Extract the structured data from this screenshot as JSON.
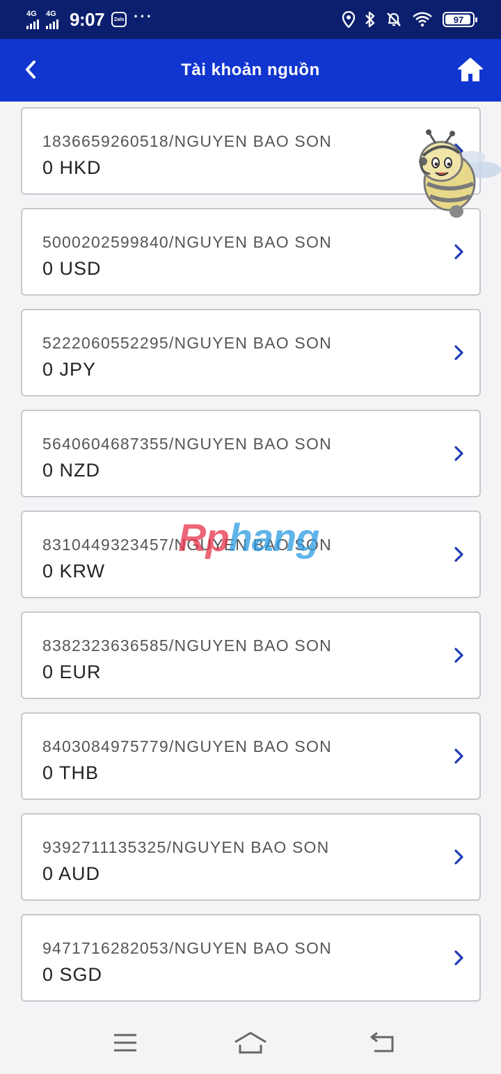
{
  "status_bar": {
    "network_1": "4G",
    "network_2": "4G",
    "time": "9:07",
    "zalo_icon_label": "Zalo",
    "more_indicator": "···",
    "battery_level": "97",
    "icons": [
      "location-icon",
      "bluetooth-icon",
      "bell-off-icon",
      "wifi-icon"
    ]
  },
  "header": {
    "title": "Tài khoản nguồn",
    "back_icon": "chevron-left-icon",
    "home_icon": "home-icon"
  },
  "accounts": [
    {
      "account": "1836659260518/NGUYEN BAO SON",
      "balance": "0 HKD"
    },
    {
      "account": "5000202599840/NGUYEN BAO SON",
      "balance": "0 USD"
    },
    {
      "account": "5222060552295/NGUYEN BAO SON",
      "balance": "0 JPY"
    },
    {
      "account": "5640604687355/NGUYEN BAO SON",
      "balance": "0 NZD"
    },
    {
      "account": "8310449323457/NGUYEN BAO SON",
      "balance": "0 KRW"
    },
    {
      "account": "8382323636585/NGUYEN BAO SON",
      "balance": "0 EUR"
    },
    {
      "account": "8403084975779/NGUYEN BAO SON",
      "balance": "0 THB"
    },
    {
      "account": "9392711135325/NGUYEN BAO SON",
      "balance": "0 AUD"
    },
    {
      "account": "9471716282053/NGUYEN BAO SON",
      "balance": "0 SGD"
    }
  ],
  "watermark": {
    "part1": "Rp",
    "part2": "hang"
  },
  "colors": {
    "status_bar": "#0c1f6e",
    "header": "#1136cf",
    "chevron": "#1d3bb3",
    "card_border": "#c7c7cc"
  },
  "nav_bar": {
    "icons": [
      "menu-icon",
      "home-outline-icon",
      "back-arrow-icon"
    ]
  }
}
